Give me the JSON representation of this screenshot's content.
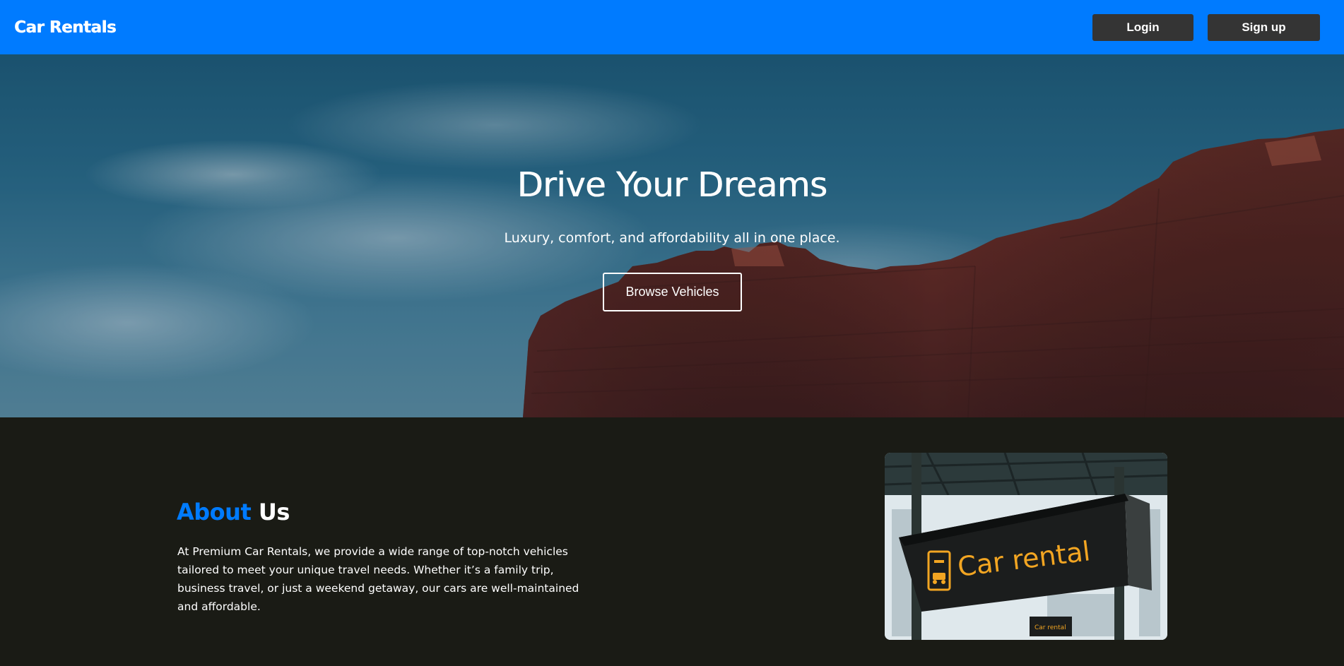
{
  "header": {
    "brand": "Car Rentals",
    "login_label": "Login",
    "signup_label": "Sign up",
    "accent_color": "#007bff"
  },
  "hero": {
    "title": "Drive Your Dreams",
    "subtitle": "Luxury, comfort, and affordability all in one place.",
    "cta_label": "Browse Vehicles"
  },
  "about": {
    "title_accent": "About",
    "title_rest": "Us",
    "body": "At Premium Car Rentals, we provide a wide range of top-notch vehicles tailored to meet your unique travel needs. Whether it’s a family trip, business travel, or just a weekend getaway, our cars are well-maintained and affordable.",
    "image_sign_text": "Car rental",
    "image_small_sign_text": "Car rental"
  }
}
